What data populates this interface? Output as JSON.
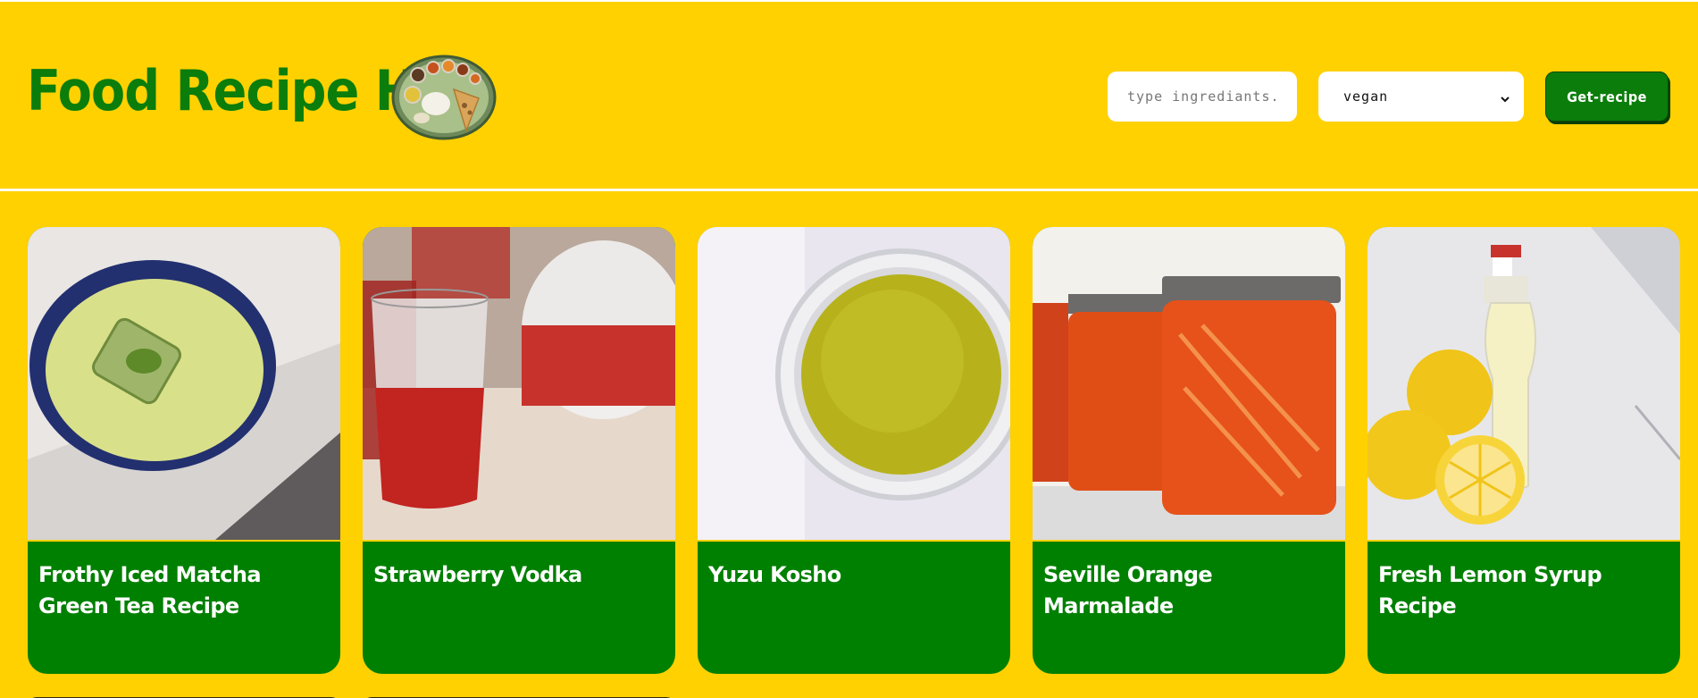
{
  "header": {
    "title": "Food Recipe Hub",
    "logo_icon": "thali-plate-icon",
    "search": {
      "placeholder": "type ingrediants.....",
      "value": ""
    },
    "diet_select": {
      "selected": "vegan"
    },
    "submit_label": "Get-recipe"
  },
  "colors": {
    "background": "#FFD100",
    "brand_green": "#0B7D0B",
    "card_green": "#008000"
  },
  "recipes": [
    {
      "title": "Frothy Iced Matcha Green Tea Recipe",
      "image": "iced-matcha-bowl-image"
    },
    {
      "title": "Strawberry Vodka",
      "image": "red-drink-glasses-image"
    },
    {
      "title": "Yuzu Kosho",
      "image": "yuzu-kosho-jar-image"
    },
    {
      "title": "Seville Orange Marmalade",
      "image": "marmalade-jars-image"
    },
    {
      "title": "Fresh Lemon Syrup Recipe",
      "image": "lemon-syrup-bottle-image"
    }
  ]
}
